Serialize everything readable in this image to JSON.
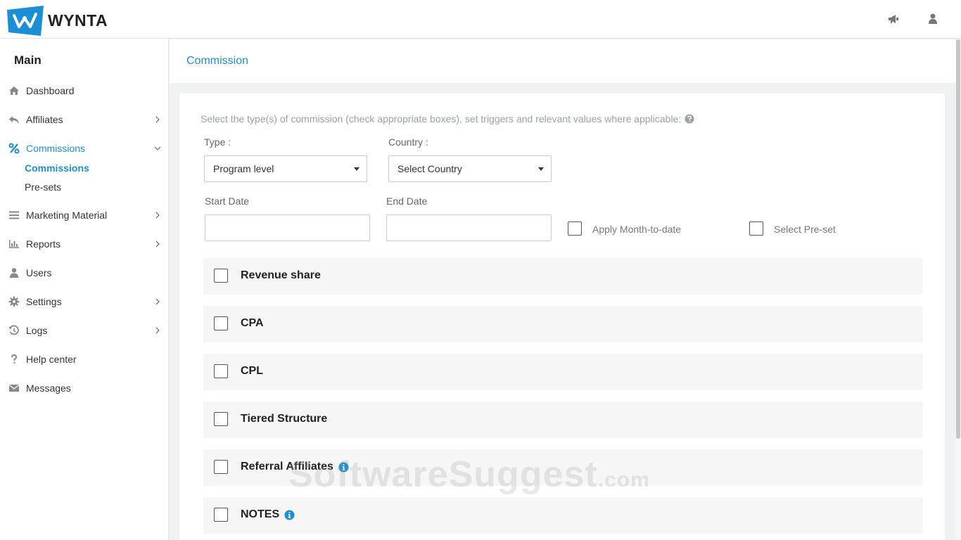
{
  "app": {
    "logo_text": "WYNTA",
    "brand_color": "#1a8fd6"
  },
  "topbar": {
    "icons": [
      "megaphone-icon",
      "user-icon"
    ]
  },
  "sidebar": {
    "section_title": "Main",
    "items": [
      {
        "label": "Dashboard",
        "icon": "home-icon"
      },
      {
        "label": "Affiliates",
        "icon": "reply-icon"
      },
      {
        "label": "Commissions",
        "icon": "percent-icon"
      },
      {
        "label": "Marketing Material",
        "icon": "menu-icon"
      },
      {
        "label": "Reports",
        "icon": "bar-chart-icon"
      },
      {
        "label": "Users",
        "icon": "user-icon"
      },
      {
        "label": "Settings",
        "icon": "gear-icon"
      },
      {
        "label": "Logs",
        "icon": "history-icon"
      },
      {
        "label": "Help center",
        "icon": "question-icon"
      },
      {
        "label": "Messages",
        "icon": "envelope-icon"
      }
    ],
    "sub_items": [
      "Commissions",
      "Pre-sets"
    ]
  },
  "page": {
    "title": "Commission"
  },
  "form": {
    "intro": "Select the type(s) of commission (check appropriate boxes), set triggers and relevant values where applicable:",
    "type_label": "Type :",
    "type_value": "Program level",
    "country_label": "Country :",
    "country_value": "Select Country",
    "start_label": "Start Date",
    "start_value": "",
    "end_label": "End Date",
    "end_value": "",
    "month_to_date_label": "Apply Month-to-date",
    "preset_label": "Select Pre-set"
  },
  "commission_types": [
    {
      "label": "Revenue share"
    },
    {
      "label": "CPA"
    },
    {
      "label": "CPL"
    },
    {
      "label": "Tiered Structure"
    },
    {
      "label": "Referral Affiliates"
    },
    {
      "label": "NOTES"
    }
  ],
  "watermark": {
    "main": "SoftwareSuggest",
    "suffix": ".com"
  }
}
